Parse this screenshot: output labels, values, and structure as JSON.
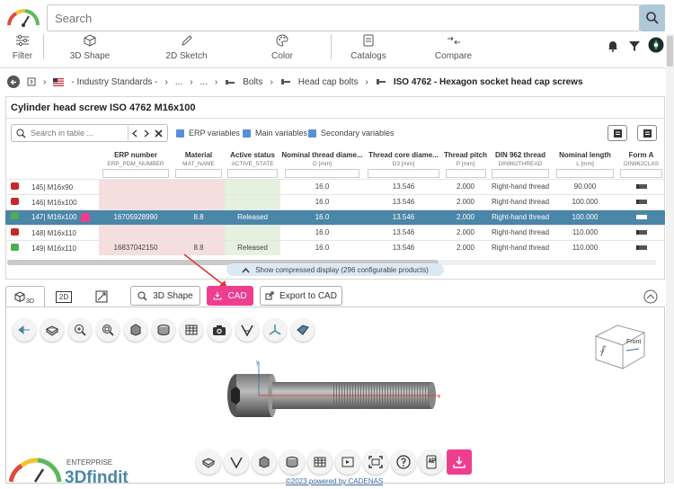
{
  "search": {
    "placeholder": "Search"
  },
  "toolbar": {
    "filter": "Filter",
    "shape3d": "3D Shape",
    "sketch2d": "2D Sketch",
    "color": "Color",
    "catalogs": "Catalogs",
    "compare": "Compare"
  },
  "breadcrumb": {
    "items": [
      "- Industry Standards -",
      "...",
      "...",
      "Bolts",
      "Head cap bolts",
      "ISO 4762 - Hexagon socket head cap screws"
    ]
  },
  "panel": {
    "title": "Cylinder head screw ISO 4762 M16x100",
    "search_placeholder": "Search in table ...",
    "checks": [
      "ERP variables",
      "Main variables",
      "Secondary variables"
    ],
    "compress_label": "Show compressed display (296 configurable products)"
  },
  "table": {
    "headers": [
      {
        "title": "",
        "sub": ""
      },
      {
        "title": "ERP number",
        "sub": "ERP_PDM_NUMBER"
      },
      {
        "title": "Material",
        "sub": "MAT_NAME"
      },
      {
        "title": "Active status",
        "sub": "ACTIVE_STATE"
      },
      {
        "title": "Nominal thread diame...",
        "sub": "D [mm]"
      },
      {
        "title": "Thread core diame...",
        "sub": "D3 [mm]"
      },
      {
        "title": "Thread pitch",
        "sub": "P [mm]"
      },
      {
        "title": "DIN 962 thread",
        "sub": "DIN962THREAD"
      },
      {
        "title": "Nominal length",
        "sub": "L [mm]"
      },
      {
        "title": "Form A",
        "sub": "DIN962CLAS"
      }
    ],
    "rows": [
      {
        "label": "145| M16x90",
        "status": "red",
        "erp": "",
        "material": "",
        "active": "",
        "d": "16.0",
        "d3": "13.546",
        "p": "2.000",
        "thread": "Right-hand thread",
        "l": "90.000"
      },
      {
        "label": "146| M16x100",
        "status": "red",
        "erp": "",
        "material": "",
        "active": "",
        "d": "16.0",
        "d3": "13.546",
        "p": "2.000",
        "thread": "Right-hand thread",
        "l": "100.000"
      },
      {
        "label": "147| M16x100",
        "status": "green",
        "erp": "16705928990",
        "material": "8.8",
        "active": "Released",
        "d": "16.0",
        "d3": "13.546",
        "p": "2.000",
        "thread": "Right-hand thread",
        "l": "100.000",
        "selected": true
      },
      {
        "label": "148| M16x110",
        "status": "red",
        "erp": "",
        "material": "",
        "active": "",
        "d": "16.0",
        "d3": "13.546",
        "p": "2.000",
        "thread": "Right-hand thread",
        "l": "110.000"
      },
      {
        "label": "149| M16x110",
        "status": "green",
        "erp": "16837042150",
        "material": "8.8",
        "active": "Released",
        "d": "16.0",
        "d3": "13.546",
        "p": "2.000",
        "thread": "Right-hand thread",
        "l": "110.000"
      }
    ]
  },
  "viewer": {
    "tab_3d": "3D",
    "tab_2d": "2D",
    "btn_3dshape": "3D Shape",
    "btn_cad": "CAD",
    "btn_export": "Export to CAD",
    "cube_front": "Front",
    "cube_left": "Left",
    "axis_x": "x",
    "axis_y": "y"
  },
  "logo": {
    "top": "ENTERPRISE",
    "bottom": "3Dfindit"
  },
  "footer": {
    "copyright": "©2023 powered by CADENAS"
  },
  "colors": {
    "accent": "#ee3e90",
    "selected_row": "#4a86a8",
    "search_button": "#aec8d8"
  }
}
